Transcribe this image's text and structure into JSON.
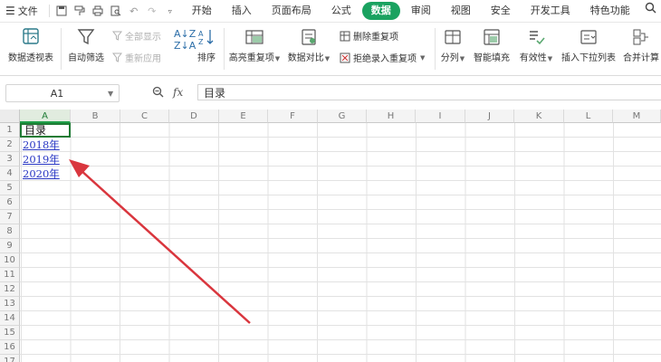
{
  "menubar": {
    "file_label": "文件",
    "tabs": [
      "开始",
      "插入",
      "页面布局",
      "公式",
      "数据",
      "审阅",
      "视图",
      "安全",
      "开发工具",
      "特色功能"
    ],
    "active_tab": "数据"
  },
  "ribbon": {
    "pivot": "数据透视表",
    "autofilter": "自动筛选",
    "show_all": "全部显示",
    "reapply": "重新应用",
    "sort": "排序",
    "highlight_dup": "高亮重复项",
    "compare": "数据对比",
    "remove_dup": "删除重复项",
    "reject_dup": "拒绝录入重复项",
    "split": "分列",
    "flash_fill": "智能填充",
    "validity": "有效性",
    "dropdown": "插入下拉列表",
    "consolidate": "合并计算"
  },
  "formula_bar": {
    "name_box": "A1",
    "fx": "fx",
    "value": "目录"
  },
  "sheet": {
    "columns": [
      "A",
      "B",
      "C",
      "D",
      "E",
      "F",
      "G",
      "H",
      "I",
      "J",
      "K",
      "L",
      "M"
    ],
    "rows": [
      "1",
      "2",
      "3",
      "4",
      "5",
      "6",
      "7",
      "8",
      "9",
      "10",
      "11",
      "12",
      "13",
      "14",
      "15",
      "16",
      "17"
    ],
    "a1": "目录",
    "a2": "2018年",
    "a3": "2019年",
    "a4": "2020年"
  },
  "colors": {
    "accent": "#1aa260",
    "link": "#2a38c4",
    "arrow": "#d9363e"
  }
}
